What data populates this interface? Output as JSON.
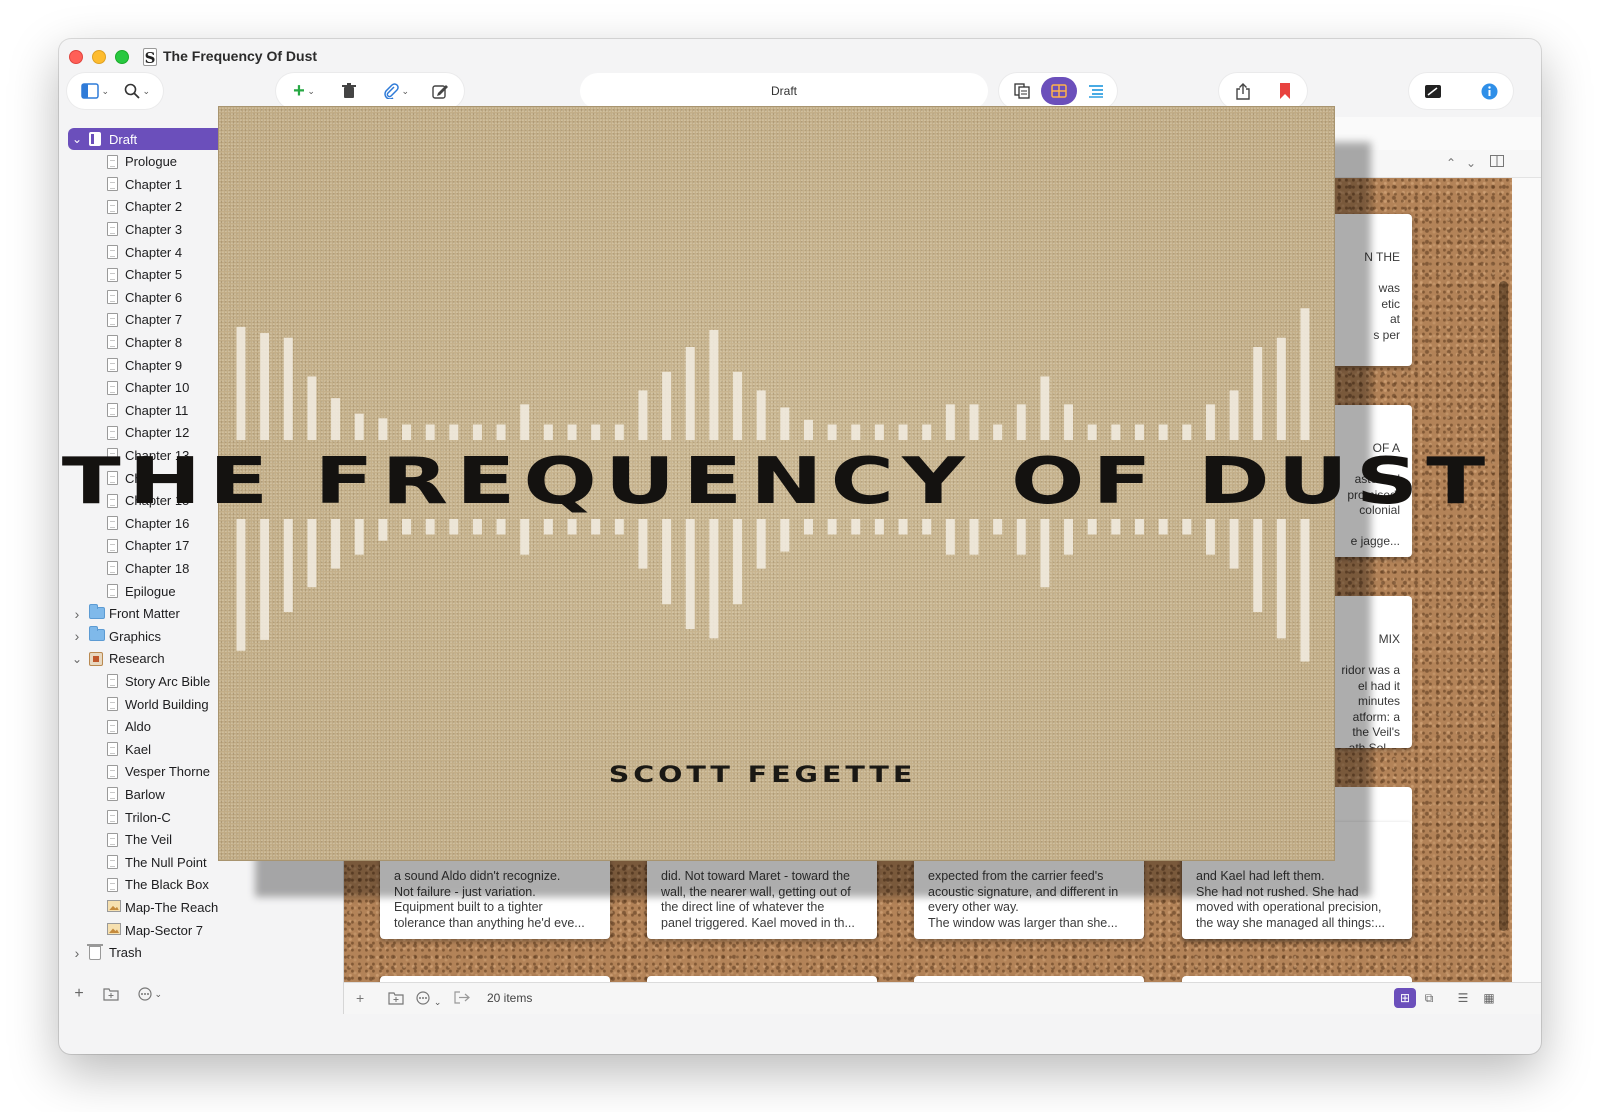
{
  "window": {
    "title": "The Frequency Of Dust"
  },
  "toolbar": {
    "location_label": "Draft"
  },
  "sidebar": {
    "rows": [
      {
        "label": "Draft",
        "kind": "draft",
        "level": 0,
        "disclosure": "expanded",
        "selected": true
      },
      {
        "label": "Prologue",
        "kind": "doc",
        "level": 1
      },
      {
        "label": "Chapter 1",
        "kind": "doc",
        "level": 1
      },
      {
        "label": "Chapter 2",
        "kind": "doc",
        "level": 1
      },
      {
        "label": "Chapter 3",
        "kind": "doc",
        "level": 1
      },
      {
        "label": "Chapter 4",
        "kind": "doc",
        "level": 1
      },
      {
        "label": "Chapter 5",
        "kind": "doc",
        "level": 1
      },
      {
        "label": "Chapter 6",
        "kind": "doc",
        "level": 1
      },
      {
        "label": "Chapter 7",
        "kind": "doc",
        "level": 1
      },
      {
        "label": "Chapter 8",
        "kind": "doc",
        "level": 1
      },
      {
        "label": "Chapter 9",
        "kind": "doc",
        "level": 1
      },
      {
        "label": "Chapter 10",
        "kind": "doc",
        "level": 1
      },
      {
        "label": "Chapter 11",
        "kind": "doc",
        "level": 1
      },
      {
        "label": "Chapter 12",
        "kind": "doc",
        "level": 1
      },
      {
        "label": "Chapter 13",
        "kind": "doc",
        "level": 1
      },
      {
        "label": "Chapter 14",
        "kind": "doc",
        "level": 1
      },
      {
        "label": "Chapter 15",
        "kind": "doc",
        "level": 1
      },
      {
        "label": "Chapter 16",
        "kind": "doc",
        "level": 1
      },
      {
        "label": "Chapter 17",
        "kind": "doc",
        "level": 1
      },
      {
        "label": "Chapter 18",
        "kind": "doc",
        "level": 1
      },
      {
        "label": "Epilogue",
        "kind": "doc",
        "level": 1
      },
      {
        "label": "Front Matter",
        "kind": "folder",
        "level": 0,
        "disclosure": "collapsed"
      },
      {
        "label": "Graphics",
        "kind": "folder",
        "level": 0,
        "disclosure": "collapsed"
      },
      {
        "label": "Research",
        "kind": "research",
        "level": 0,
        "disclosure": "expanded"
      },
      {
        "label": "Story Arc Bible",
        "kind": "doc",
        "level": 1
      },
      {
        "label": "World Building",
        "kind": "doc",
        "level": 1
      },
      {
        "label": "Aldo",
        "kind": "doc",
        "level": 1
      },
      {
        "label": "Kael",
        "kind": "doc",
        "level": 1
      },
      {
        "label": "Vesper Thorne",
        "kind": "doc",
        "level": 1
      },
      {
        "label": "Barlow",
        "kind": "doc",
        "level": 1
      },
      {
        "label": "Trilon-C",
        "kind": "doc",
        "level": 1
      },
      {
        "label": "The Veil",
        "kind": "doc",
        "level": 1
      },
      {
        "label": "The Null Point",
        "kind": "doc",
        "level": 1
      },
      {
        "label": "The Black Box",
        "kind": "doc",
        "level": 1
      },
      {
        "label": "Map-The Reach",
        "kind": "image",
        "level": 1
      },
      {
        "label": "Map-Sector 7",
        "kind": "image",
        "level": 1
      },
      {
        "label": "Trash",
        "kind": "trash",
        "level": 0,
        "disclosure": "collapsed"
      }
    ]
  },
  "corkboard": {
    "right_cards": [
      {
        "title": "N THE",
        "lines": [
          "was",
          "etic",
          "at",
          "s per"
        ]
      },
      {
        "title": "OF A",
        "lines": [
          "asteland",
          "promised.",
          "colonial",
          "",
          "e jagge..."
        ]
      },
      {
        "title": "MIX",
        "lines": [
          "ridor was a",
          "el had it",
          "minutes",
          "atform: a",
          "the Veil's",
          "ath Sol-..."
        ]
      },
      {
        "title": "TIME",
        "lines": [
          "'s",
          "er Aldo"
        ]
      }
    ],
    "bottom_cards": [
      {
        "lines": [
          "a sound Aldo didn't recognize.",
          "Not failure - just variation.",
          "Equipment built to a tighter",
          "tolerance than anything he'd eve..."
        ]
      },
      {
        "lines": [
          "did. Not toward Maret - toward the",
          "wall, the nearer wall, getting out of",
          "the direct line of whatever the",
          "panel triggered. Kael moved in th..."
        ]
      },
      {
        "lines": [
          "expected from the carrier feed's",
          "acoustic signature, and different in",
          "every other way.",
          "The window was larger than she..."
        ]
      },
      {
        "lines": [
          "and Kael had left them.",
          "She had not rushed. She had",
          "moved with operational precision,",
          "the way she managed all things:..."
        ]
      }
    ]
  },
  "footer": {
    "items_count": "20 items"
  },
  "cover": {
    "title": "THE FREQUENCY OF DUST",
    "author": "SCOTT FEGETTE",
    "bars_top": [
      0.73,
      0.69,
      0.66,
      0.41,
      0.27,
      0.17,
      0.14,
      0.1,
      0.1,
      0.1,
      0.1,
      0.1,
      0.23,
      0.1,
      0.1,
      0.1,
      0.1,
      0.32,
      0.44,
      0.6,
      0.71,
      0.44,
      0.32,
      0.21,
      0.13,
      0.1,
      0.1,
      0.1,
      0.1,
      0.1,
      0.23,
      0.23,
      0.1,
      0.23,
      0.41,
      0.23,
      0.1,
      0.1,
      0.1,
      0.1,
      0.1,
      0.23,
      0.32,
      0.6,
      0.66,
      0.85
    ],
    "bars_bottom": [
      0.85,
      0.78,
      0.6,
      0.44,
      0.32,
      0.23,
      0.14,
      0.1,
      0.1,
      0.1,
      0.1,
      0.1,
      0.23,
      0.1,
      0.1,
      0.1,
      0.1,
      0.32,
      0.55,
      0.71,
      0.77,
      0.55,
      0.32,
      0.21,
      0.1,
      0.1,
      0.1,
      0.1,
      0.1,
      0.1,
      0.23,
      0.23,
      0.1,
      0.23,
      0.44,
      0.23,
      0.1,
      0.1,
      0.1,
      0.1,
      0.1,
      0.23,
      0.32,
      0.6,
      0.77,
      0.92
    ],
    "colors": {
      "background": "#c4ae88",
      "bars": "#f1ece0",
      "text": "#141210"
    }
  },
  "colors": {
    "accent": "#6b4fbb",
    "cork": "#b38358"
  }
}
